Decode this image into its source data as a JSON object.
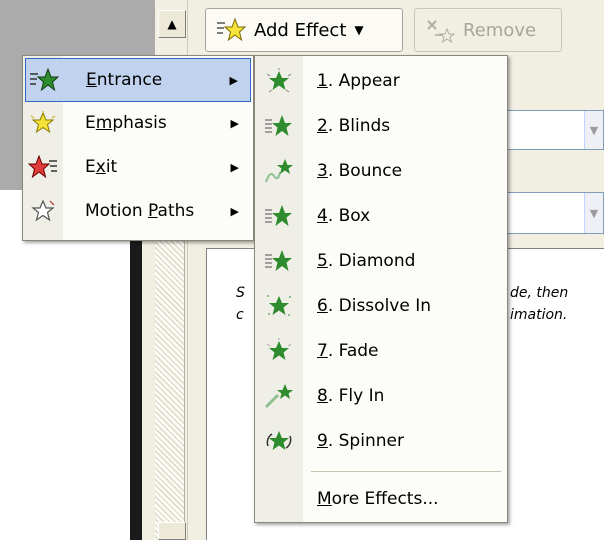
{
  "toolbar": {
    "scroll_up_glyph": "▲",
    "add_effect_label": "Add Effect",
    "add_effect_arrow": "▼",
    "remove_label": "Remove"
  },
  "hint": {
    "left_line1": "S",
    "left_line2": "c",
    "right_line1": "de, then",
    "right_line2": "imation."
  },
  "main_menu": {
    "items": [
      {
        "label": "Entrance",
        "mnemonic": "E",
        "rest": "ntrance",
        "icon": "entrance-star-icon",
        "has_submenu": true,
        "highlighted": true
      },
      {
        "label": "Emphasis",
        "mnemonic": "m",
        "pre": "E",
        "rest": "phasis",
        "icon": "emphasis-star-icon",
        "has_submenu": true
      },
      {
        "label": "Exit",
        "mnemonic": "x",
        "pre": "E",
        "rest": "it",
        "icon": "exit-star-icon",
        "has_submenu": true
      },
      {
        "label": "Motion Paths",
        "mnemonic": "P",
        "pre": "Motion ",
        "rest": "aths",
        "icon": "motion-path-star-icon",
        "has_submenu": true
      }
    ],
    "submenu_glyph": "▶"
  },
  "entrance_submenu": {
    "items": [
      {
        "num": "1",
        "text": ". Appear",
        "icon": "appear-icon"
      },
      {
        "num": "2",
        "text": ". Blinds",
        "icon": "blinds-icon"
      },
      {
        "num": "3",
        "text": ". Bounce",
        "icon": "bounce-icon"
      },
      {
        "num": "4",
        "text": ". Box",
        "icon": "box-icon"
      },
      {
        "num": "5",
        "text": ". Diamond",
        "icon": "diamond-icon"
      },
      {
        "num": "6",
        "text": ". Dissolve In",
        "icon": "dissolve-in-icon"
      },
      {
        "num": "7",
        "text": ". Fade",
        "icon": "fade-icon"
      },
      {
        "num": "8",
        "text": ". Fly In",
        "icon": "fly-in-icon"
      },
      {
        "num": "9",
        "text": ". Spinner",
        "icon": "spinner-icon"
      }
    ],
    "more_mnemonic": "M",
    "more_rest": "ore Effects..."
  },
  "colors": {
    "highlight_bg": "#c1d2ee",
    "highlight_border": "#316ac5",
    "entrance_green": "#2e8b2e",
    "emphasis_yellow": "#f5e33a",
    "exit_red": "#e03a3a"
  }
}
